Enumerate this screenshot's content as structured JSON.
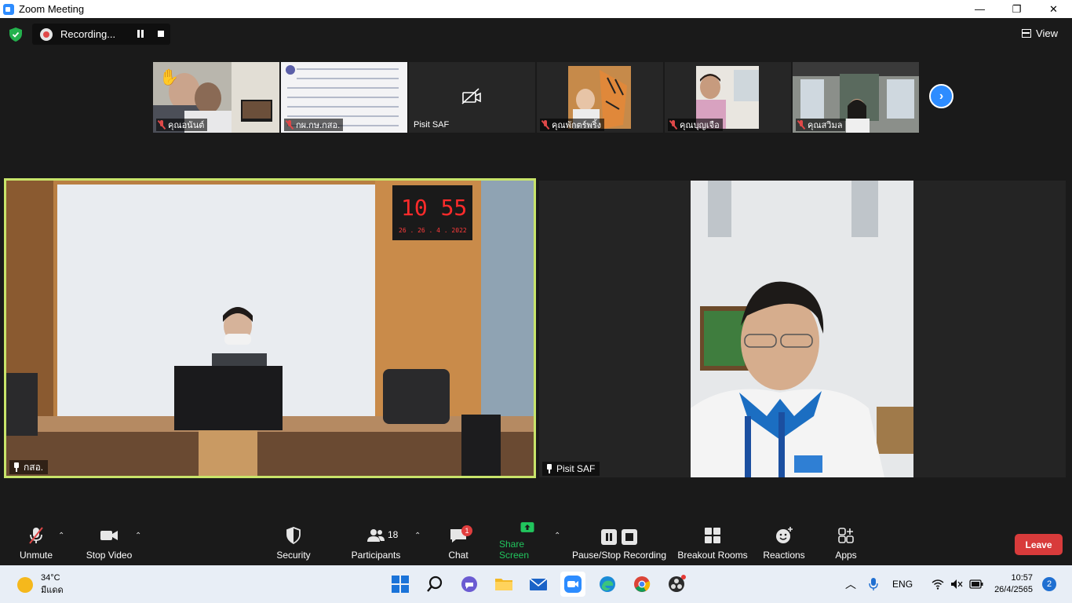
{
  "window": {
    "title": "Zoom Meeting",
    "controls": {
      "minimize": "—",
      "restore": "❐",
      "close": "✕"
    }
  },
  "recording": {
    "label": "Recording..."
  },
  "view": {
    "label": "View"
  },
  "thumbnails": [
    {
      "name": "คุณอนันต์",
      "muted": true
    },
    {
      "name": "กผ.กษ.กสอ.",
      "muted": true
    },
    {
      "name": "Pisit SAF",
      "muted": false
    },
    {
      "name": "คุณพักตร์พริ้ง",
      "muted": true
    },
    {
      "name": "คุณบุญเจือ",
      "muted": true
    },
    {
      "name": "คุณสวิมล",
      "muted": true
    }
  ],
  "main_videos": {
    "left": {
      "name": "กสอ.",
      "clock_text": "10 55",
      "date_text": "26 . 26 . 4 . 2022"
    },
    "right": {
      "name": "Pisit SAF"
    }
  },
  "toolbar": {
    "unmute": "Unmute",
    "stop_video": "Stop Video",
    "security": "Security",
    "participants": "Participants",
    "participants_count": "18",
    "chat": "Chat",
    "chat_badge": "1",
    "share_screen": "Share Screen",
    "pause_stop_recording": "Pause/Stop Recording",
    "breakout_rooms": "Breakout Rooms",
    "reactions": "Reactions",
    "apps": "Apps",
    "leave": "Leave",
    "colors": {
      "share": "#21c55d",
      "leave": "#d83b3b",
      "accent": "#2d8cff"
    }
  },
  "taskbar": {
    "weather_temp": "34°C",
    "weather_desc": "มีแดด",
    "language": "ENG",
    "time": "10:57",
    "date": "26/4/2565",
    "notifications": "2",
    "apps": [
      "windows-start",
      "search",
      "teams-chat",
      "file-explorer",
      "mail",
      "zoom",
      "edge",
      "chrome",
      "obs"
    ]
  }
}
